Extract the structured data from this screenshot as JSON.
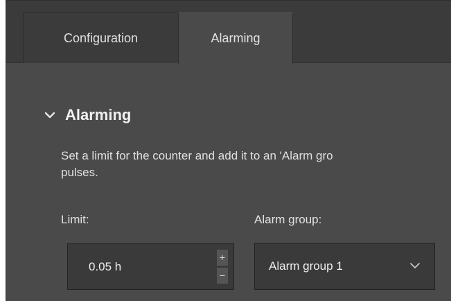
{
  "tabs": [
    {
      "label": "Configuration",
      "active": false
    },
    {
      "label": "Alarming",
      "active": true
    }
  ],
  "section": {
    "title": "Alarming",
    "expanded": true,
    "description_line1": "Set a limit for the counter and add it to an 'Alarm gro",
    "description_line2": "pulses."
  },
  "limit": {
    "label": "Limit:",
    "value": "0.05 h",
    "increment": "+",
    "decrement": "−"
  },
  "alarm_group": {
    "label": "Alarm group:",
    "selected": "Alarm group 1"
  },
  "icons": {
    "section_toggle": "chevron-down-icon",
    "select_arrow": "chevron-down-icon"
  },
  "colors": {
    "panel_bg": "#4a4a4a",
    "tabbar_bg": "#3b3b3b",
    "input_bg": "#3a3a3a",
    "text": "#e0e0e0"
  }
}
